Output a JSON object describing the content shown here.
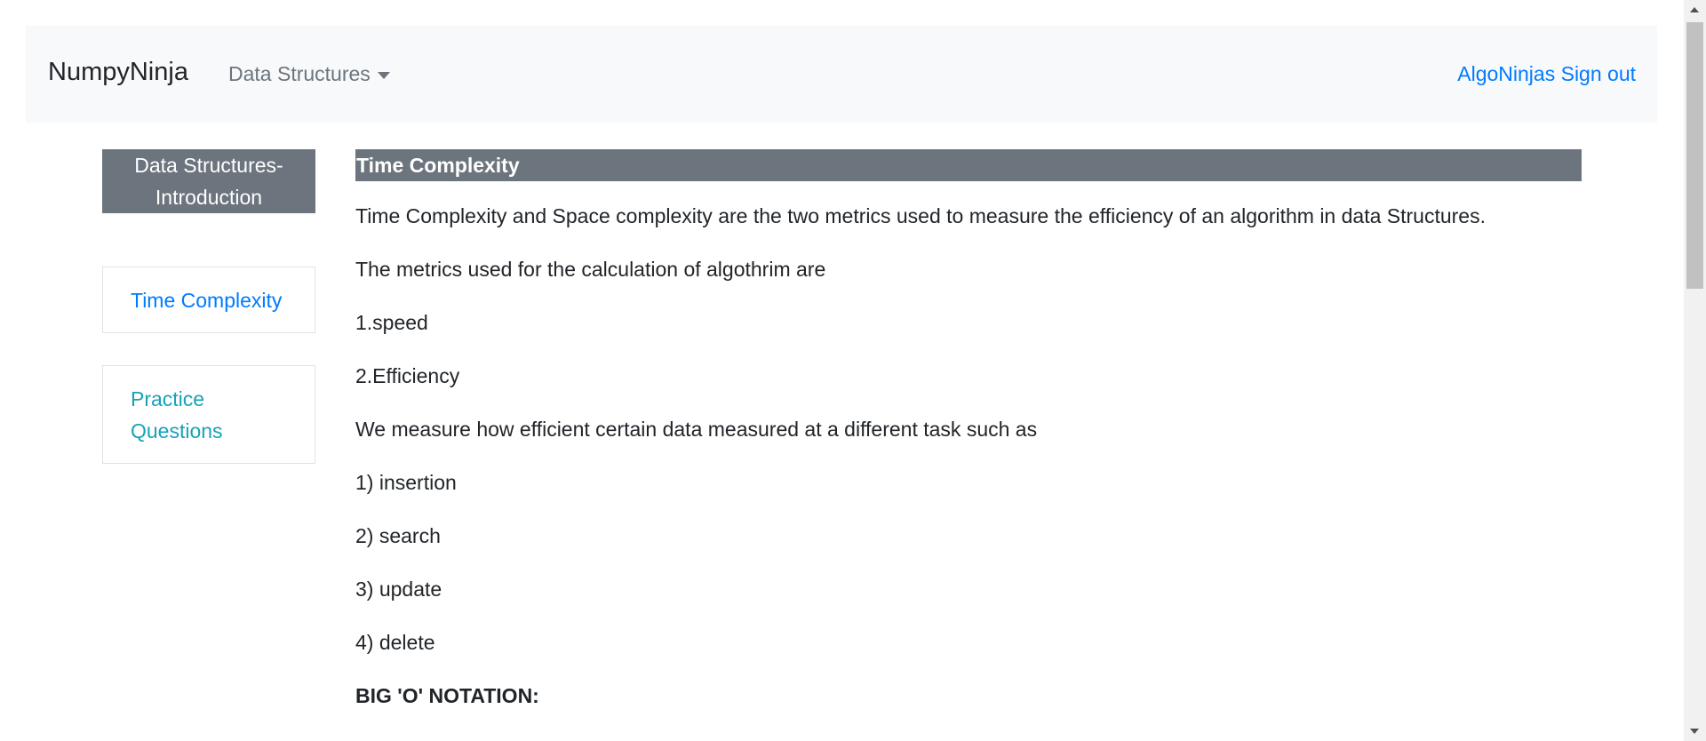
{
  "navbar": {
    "brand": "NumpyNinja",
    "dropdown_label": "Data Structures",
    "user_link": "AlgoNinjas Sign out"
  },
  "sidebar": {
    "header": "Data Structures-Introduction",
    "items": [
      {
        "label": "Time Complexity"
      },
      {
        "label": "Practice Questions"
      }
    ]
  },
  "content": {
    "title": "Time Complexity",
    "paragraphs": [
      "Time Complexity and Space complexity are the two metrics used to measure the efficiency of an algorithm in data Structures.",
      "The metrics used for the calculation of algothrim are",
      "1.speed",
      "2.Efficiency",
      "We measure how efficient certain data measured at a different task such as",
      "1) insertion",
      "2) search",
      "3) update",
      "4) delete",
      "BIG 'O' NOTATION:"
    ]
  },
  "colors": {
    "navbar_bg": "#f8f9fa",
    "header_bg": "#6c757d",
    "link_blue": "#007bff",
    "link_teal": "#17a2b8"
  }
}
